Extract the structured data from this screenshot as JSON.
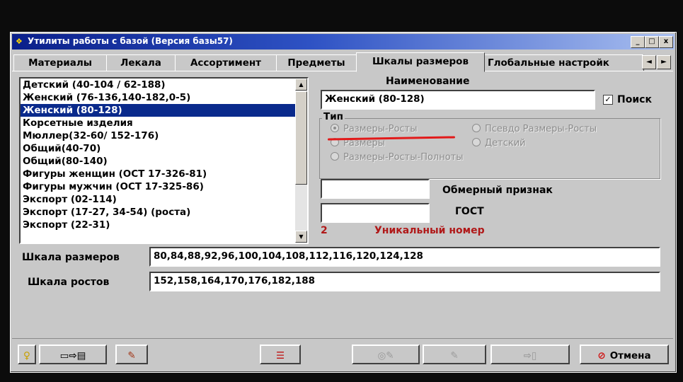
{
  "window": {
    "title": "Утилиты работы с базой (Версия базы57)",
    "min_label": "_",
    "max_label": "□",
    "close_label": "x"
  },
  "tabs": [
    {
      "label": "Материалы"
    },
    {
      "label": "Лекала"
    },
    {
      "label": "Ассортимент"
    },
    {
      "label": "Предметы"
    },
    {
      "label": "Шкалы размеров"
    },
    {
      "label": "Глобальные настройк"
    }
  ],
  "active_tab": "Шкалы размеров",
  "tab_scroll": {
    "left": "◄",
    "right": "►"
  },
  "list": {
    "items": [
      "Детский (40-104 / 62-188)",
      "Женский (76-136,140-182,0-5)",
      "Женский (80-128)",
      "Корсетные изделия",
      "Мюллер(32-60/ 152-176)",
      "Общий(40-70)",
      "Общий(80-140)",
      "Фигуры женщин (ОСТ 17-326-81)",
      "Фигуры мужчин (ОСТ 17-325-86)",
      "Экспорт (02-114)",
      "Экспорт (17-27, 34-54) (роста)",
      "Экспорт (22-31)"
    ],
    "selected_index": 2
  },
  "name_section": {
    "header": "Наименование",
    "value": "Женский (80-128)",
    "search_label": "Поиск",
    "search_checked": true,
    "check_mark": "✓"
  },
  "type_group": {
    "title": "Тип",
    "options": [
      "Размеры-Росты",
      "Псевдо Размеры-Росты",
      "Размеры",
      "Детский",
      "Размеры-Росты-Полноты"
    ],
    "selected": "Размеры-Росты"
  },
  "measure_label": "Обмерный признак",
  "measure_value": "",
  "gost_label": "ГОСТ",
  "gost_value": "",
  "unique": {
    "number": "2",
    "label": "Уникальный номер",
    "color": "#b01818"
  },
  "size_scale": {
    "label": "Шкала размеров",
    "value": "80,84,88,92,96,100,104,108,112,116,120,124,128"
  },
  "height_scale": {
    "label": "Шкала ростов",
    "value": "152,158,164,170,176,182,188"
  },
  "buttons": {
    "cancel_label": "Отмена"
  },
  "colors": {
    "selection": "#0a2a8c",
    "title_start": "#0a1f8a",
    "annotation_red": "#e21a1a"
  }
}
